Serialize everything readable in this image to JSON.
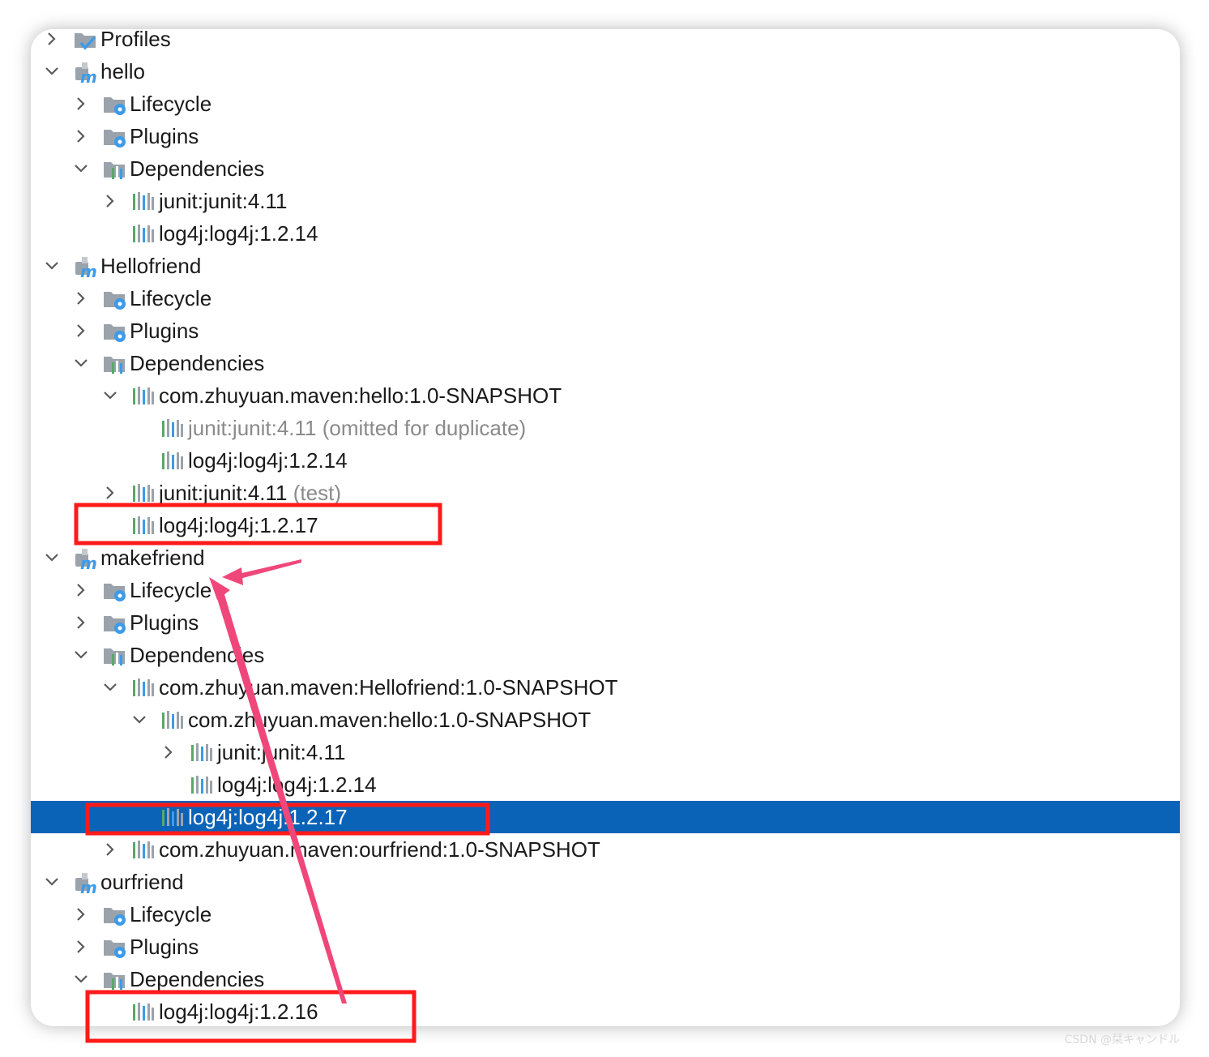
{
  "tree": [
    {
      "indent": 0,
      "expand": "collapsed",
      "icon": "profiles-icon",
      "label": "Profiles",
      "suffix": ""
    },
    {
      "indent": 0,
      "expand": "expanded",
      "icon": "maven-module-icon",
      "label": "hello",
      "suffix": ""
    },
    {
      "indent": 1,
      "expand": "collapsed",
      "icon": "lifecycle-folder-icon",
      "label": "Lifecycle",
      "suffix": ""
    },
    {
      "indent": 1,
      "expand": "collapsed",
      "icon": "plugins-folder-icon",
      "label": "Plugins",
      "suffix": ""
    },
    {
      "indent": 1,
      "expand": "expanded",
      "icon": "dependencies-folder-icon",
      "label": "Dependencies",
      "suffix": ""
    },
    {
      "indent": 2,
      "expand": "collapsed",
      "icon": "library-icon",
      "label": "junit:junit:4.11",
      "suffix": ""
    },
    {
      "indent": 2,
      "expand": "none",
      "icon": "library-icon",
      "label": "log4j:log4j:1.2.14",
      "suffix": ""
    },
    {
      "indent": 0,
      "expand": "expanded",
      "icon": "maven-module-icon",
      "label": "Hellofriend",
      "suffix": ""
    },
    {
      "indent": 1,
      "expand": "collapsed",
      "icon": "lifecycle-folder-icon",
      "label": "Lifecycle",
      "suffix": ""
    },
    {
      "indent": 1,
      "expand": "collapsed",
      "icon": "plugins-folder-icon",
      "label": "Plugins",
      "suffix": ""
    },
    {
      "indent": 1,
      "expand": "expanded",
      "icon": "dependencies-folder-icon",
      "label": "Dependencies",
      "suffix": ""
    },
    {
      "indent": 2,
      "expand": "expanded",
      "icon": "library-icon",
      "label": "com.zhuyuan.maven:hello:1.0-SNAPSHOT",
      "suffix": ""
    },
    {
      "indent": 3,
      "expand": "none",
      "icon": "library-icon",
      "label": "junit:junit:4.11",
      "suffix": "(omitted for duplicate)",
      "muted": true
    },
    {
      "indent": 3,
      "expand": "none",
      "icon": "library-icon",
      "label": "log4j:log4j:1.2.14",
      "suffix": ""
    },
    {
      "indent": 2,
      "expand": "collapsed",
      "icon": "library-icon",
      "label": "junit:junit:4.11",
      "suffix": "(test)"
    },
    {
      "indent": 2,
      "expand": "none",
      "icon": "library-icon",
      "label": "log4j:log4j:1.2.17",
      "suffix": ""
    },
    {
      "indent": 0,
      "expand": "expanded",
      "icon": "maven-module-icon",
      "label": "makefriend",
      "suffix": ""
    },
    {
      "indent": 1,
      "expand": "collapsed",
      "icon": "lifecycle-folder-icon",
      "label": "Lifecycle",
      "suffix": ""
    },
    {
      "indent": 1,
      "expand": "collapsed",
      "icon": "plugins-folder-icon",
      "label": "Plugins",
      "suffix": ""
    },
    {
      "indent": 1,
      "expand": "expanded",
      "icon": "dependencies-folder-icon",
      "label": "Dependencies",
      "suffix": ""
    },
    {
      "indent": 2,
      "expand": "expanded",
      "icon": "library-icon",
      "label": "com.zhuyuan.maven:Hellofriend:1.0-SNAPSHOT",
      "suffix": ""
    },
    {
      "indent": 3,
      "expand": "expanded",
      "icon": "library-icon",
      "label": "com.zhuyuan.maven:hello:1.0-SNAPSHOT",
      "suffix": ""
    },
    {
      "indent": 4,
      "expand": "collapsed",
      "icon": "library-icon",
      "label": "junit:junit:4.11",
      "suffix": ""
    },
    {
      "indent": 4,
      "expand": "none",
      "icon": "library-icon",
      "label": "log4j:log4j:1.2.14",
      "suffix": ""
    },
    {
      "indent": 3,
      "expand": "none",
      "icon": "library-icon",
      "label": "log4j:log4j:1.2.17",
      "suffix": "",
      "selected": true
    },
    {
      "indent": 2,
      "expand": "collapsed",
      "icon": "library-icon",
      "label": "com.zhuyuan.maven:ourfriend:1.0-SNAPSHOT",
      "suffix": ""
    },
    {
      "indent": 0,
      "expand": "expanded",
      "icon": "maven-module-icon",
      "label": "ourfriend",
      "suffix": ""
    },
    {
      "indent": 1,
      "expand": "collapsed",
      "icon": "lifecycle-folder-icon",
      "label": "Lifecycle",
      "suffix": ""
    },
    {
      "indent": 1,
      "expand": "collapsed",
      "icon": "plugins-folder-icon",
      "label": "Plugins",
      "suffix": ""
    },
    {
      "indent": 1,
      "expand": "expanded",
      "icon": "dependencies-folder-icon",
      "label": "Dependencies",
      "suffix": ""
    },
    {
      "indent": 2,
      "expand": "none",
      "icon": "library-icon",
      "label": "log4j:log4j:1.2.16",
      "suffix": ""
    }
  ],
  "colors": {
    "selection": "#0b63b8",
    "highlight_box": "#ff1a1a",
    "arrow": "#f0477a",
    "icon_gray": "#9aa3ab",
    "icon_green": "#59a869",
    "icon_blue": "#3d9be9"
  },
  "watermark": "CSDN @栞キャンドル"
}
